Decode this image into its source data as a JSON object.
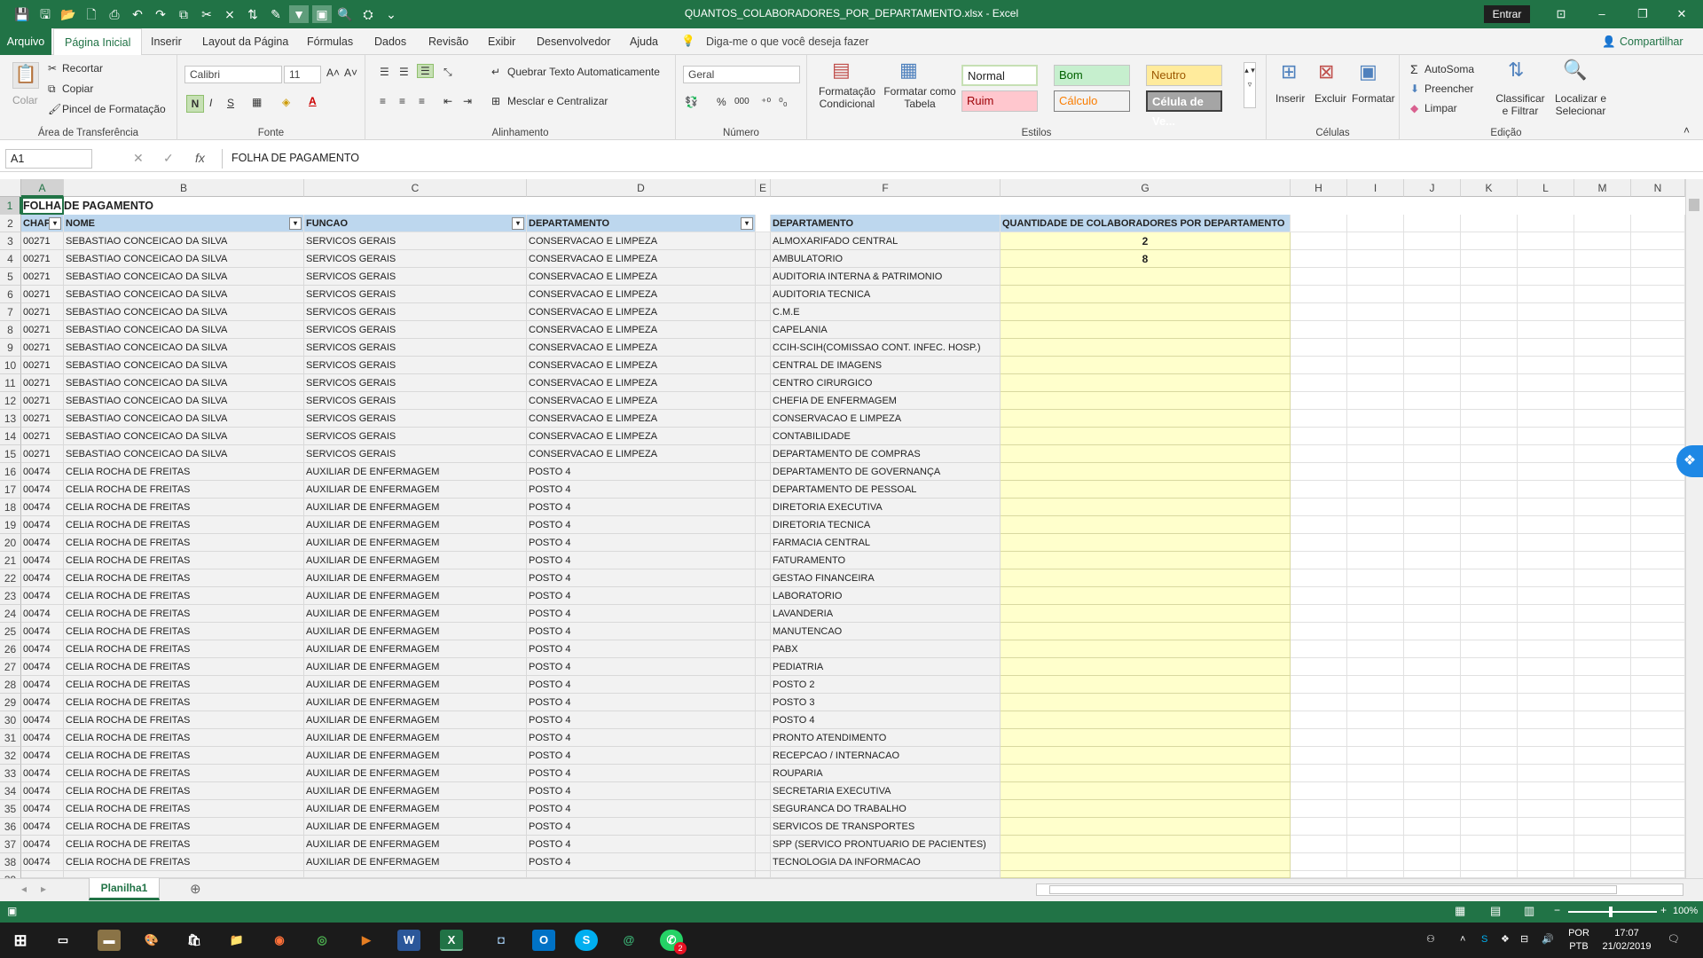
{
  "window": {
    "title": "QUANTOS_COLABORADORES_POR_DEPARTAMENTO.xlsx  -  Excel",
    "signin_label": "Entrar",
    "min": "–",
    "restore": "❐",
    "close": "✕",
    "ribbon_display": "⊡",
    "qat": [
      "💾",
      "🖫",
      "📂",
      "🗋",
      "⎙",
      "↶",
      "↷",
      "⧉",
      "✂",
      "⨯",
      "⇅",
      "✎",
      "▼",
      "▣",
      "🔍",
      "⛭",
      "⌄"
    ]
  },
  "tabs": {
    "file": "Arquivo",
    "items": [
      "Página Inicial",
      "Inserir",
      "Layout da Página",
      "Fórmulas",
      "Dados",
      "Revisão",
      "Exibir",
      "Desenvolvedor",
      "Ajuda"
    ],
    "active": "Página Inicial",
    "tell_me": "Diga-me o que você deseja fazer",
    "share": "Compartilhar"
  },
  "ribbon": {
    "clipboard": {
      "label": "Área de Transferência",
      "paste": "Colar",
      "cut": "Recortar",
      "copy": "Copiar",
      "painter": "Pincel de Formatação"
    },
    "font": {
      "label": "Fonte",
      "name": "Calibri",
      "size": "11",
      "bold": "N",
      "italic": "I",
      "underline": "S",
      "grow": "A˄",
      "shrink": "A˅"
    },
    "alignment": {
      "label": "Alinhamento",
      "wrap": "Quebrar Texto Automaticamente",
      "merge": "Mesclar e Centralizar"
    },
    "number": {
      "label": "Número",
      "format": "Geral",
      "percent": "%",
      "thousands": "000",
      "inc_dec": "⁺⁰",
      "dec_dec": "⁰₀"
    },
    "styles": {
      "label": "Estilos",
      "conditional": "Formatação Condicional",
      "as_table": "Formatar como Tabela",
      "normal": "Normal",
      "good": "Bom",
      "neutral": "Neutro",
      "bad": "Ruim",
      "calc": "Cálculo",
      "check": "Célula de Ve..."
    },
    "cells": {
      "label": "Células",
      "insert": "Inserir",
      "delete": "Excluir",
      "format": "Formatar"
    },
    "editing": {
      "label": "Edição",
      "autosum": "AutoSoma",
      "fill": "Preencher",
      "clear": "Limpar",
      "sort": "Classificar e Filtrar",
      "find": "Localizar e Selecionar"
    }
  },
  "formula_bar": {
    "name_box": "A1",
    "fx": "fx",
    "cancel": "✕",
    "enter": "✓",
    "content": "FOLHA DE PAGAMENTO"
  },
  "sheet": {
    "columns": [
      "A",
      "B",
      "C",
      "D",
      "E",
      "F",
      "G",
      "H",
      "I",
      "J",
      "K",
      "L",
      "M",
      "N"
    ],
    "title": "FOLHA DE PAGAMENTO",
    "headers_left": [
      "CHAPA",
      "NOME",
      "FUNCAO",
      "DEPARTAMENTO"
    ],
    "headers_right": [
      "DEPARTAMENTO",
      "QUANTIDADE DE COLABORADORES POR DEPARTAMENTO"
    ],
    "filter_glyph": "▾",
    "rows_left": [
      [
        "00271",
        "SEBASTIAO CONCEICAO DA SILVA",
        "SERVICOS GERAIS",
        "CONSERVACAO E LIMPEZA"
      ],
      [
        "00271",
        "SEBASTIAO CONCEICAO DA SILVA",
        "SERVICOS GERAIS",
        "CONSERVACAO E LIMPEZA"
      ],
      [
        "00271",
        "SEBASTIAO CONCEICAO DA SILVA",
        "SERVICOS GERAIS",
        "CONSERVACAO E LIMPEZA"
      ],
      [
        "00271",
        "SEBASTIAO CONCEICAO DA SILVA",
        "SERVICOS GERAIS",
        "CONSERVACAO E LIMPEZA"
      ],
      [
        "00271",
        "SEBASTIAO CONCEICAO DA SILVA",
        "SERVICOS GERAIS",
        "CONSERVACAO E LIMPEZA"
      ],
      [
        "00271",
        "SEBASTIAO CONCEICAO DA SILVA",
        "SERVICOS GERAIS",
        "CONSERVACAO E LIMPEZA"
      ],
      [
        "00271",
        "SEBASTIAO CONCEICAO DA SILVA",
        "SERVICOS GERAIS",
        "CONSERVACAO E LIMPEZA"
      ],
      [
        "00271",
        "SEBASTIAO CONCEICAO DA SILVA",
        "SERVICOS GERAIS",
        "CONSERVACAO E LIMPEZA"
      ],
      [
        "00271",
        "SEBASTIAO CONCEICAO DA SILVA",
        "SERVICOS GERAIS",
        "CONSERVACAO E LIMPEZA"
      ],
      [
        "00271",
        "SEBASTIAO CONCEICAO DA SILVA",
        "SERVICOS GERAIS",
        "CONSERVACAO E LIMPEZA"
      ],
      [
        "00271",
        "SEBASTIAO CONCEICAO DA SILVA",
        "SERVICOS GERAIS",
        "CONSERVACAO E LIMPEZA"
      ],
      [
        "00271",
        "SEBASTIAO CONCEICAO DA SILVA",
        "SERVICOS GERAIS",
        "CONSERVACAO E LIMPEZA"
      ],
      [
        "00271",
        "SEBASTIAO CONCEICAO DA SILVA",
        "SERVICOS GERAIS",
        "CONSERVACAO E LIMPEZA"
      ],
      [
        "00474",
        "CELIA ROCHA DE FREITAS",
        "AUXILIAR DE ENFERMAGEM",
        "POSTO 4"
      ],
      [
        "00474",
        "CELIA ROCHA DE FREITAS",
        "AUXILIAR DE ENFERMAGEM",
        "POSTO 4"
      ],
      [
        "00474",
        "CELIA ROCHA DE FREITAS",
        "AUXILIAR DE ENFERMAGEM",
        "POSTO 4"
      ],
      [
        "00474",
        "CELIA ROCHA DE FREITAS",
        "AUXILIAR DE ENFERMAGEM",
        "POSTO 4"
      ],
      [
        "00474",
        "CELIA ROCHA DE FREITAS",
        "AUXILIAR DE ENFERMAGEM",
        "POSTO 4"
      ],
      [
        "00474",
        "CELIA ROCHA DE FREITAS",
        "AUXILIAR DE ENFERMAGEM",
        "POSTO 4"
      ],
      [
        "00474",
        "CELIA ROCHA DE FREITAS",
        "AUXILIAR DE ENFERMAGEM",
        "POSTO 4"
      ],
      [
        "00474",
        "CELIA ROCHA DE FREITAS",
        "AUXILIAR DE ENFERMAGEM",
        "POSTO 4"
      ],
      [
        "00474",
        "CELIA ROCHA DE FREITAS",
        "AUXILIAR DE ENFERMAGEM",
        "POSTO 4"
      ],
      [
        "00474",
        "CELIA ROCHA DE FREITAS",
        "AUXILIAR DE ENFERMAGEM",
        "POSTO 4"
      ],
      [
        "00474",
        "CELIA ROCHA DE FREITAS",
        "AUXILIAR DE ENFERMAGEM",
        "POSTO 4"
      ],
      [
        "00474",
        "CELIA ROCHA DE FREITAS",
        "AUXILIAR DE ENFERMAGEM",
        "POSTO 4"
      ],
      [
        "00474",
        "CELIA ROCHA DE FREITAS",
        "AUXILIAR DE ENFERMAGEM",
        "POSTO 4"
      ],
      [
        "00474",
        "CELIA ROCHA DE FREITAS",
        "AUXILIAR DE ENFERMAGEM",
        "POSTO 4"
      ],
      [
        "00474",
        "CELIA ROCHA DE FREITAS",
        "AUXILIAR DE ENFERMAGEM",
        "POSTO 4"
      ],
      [
        "00474",
        "CELIA ROCHA DE FREITAS",
        "AUXILIAR DE ENFERMAGEM",
        "POSTO 4"
      ],
      [
        "00474",
        "CELIA ROCHA DE FREITAS",
        "AUXILIAR DE ENFERMAGEM",
        "POSTO 4"
      ],
      [
        "00474",
        "CELIA ROCHA DE FREITAS",
        "AUXILIAR DE ENFERMAGEM",
        "POSTO 4"
      ],
      [
        "00474",
        "CELIA ROCHA DE FREITAS",
        "AUXILIAR DE ENFERMAGEM",
        "POSTO 4"
      ],
      [
        "00474",
        "CELIA ROCHA DE FREITAS",
        "AUXILIAR DE ENFERMAGEM",
        "POSTO 4"
      ],
      [
        "00474",
        "CELIA ROCHA DE FREITAS",
        "AUXILIAR DE ENFERMAGEM",
        "POSTO 4"
      ],
      [
        "00474",
        "CELIA ROCHA DE FREITAS",
        "AUXILIAR DE ENFERMAGEM",
        "POSTO 4"
      ],
      [
        "00474",
        "CELIA ROCHA DE FREITAS",
        "AUXILIAR DE ENFERMAGEM",
        "POSTO 4"
      ]
    ],
    "rows_right": [
      [
        "ALMOXARIFADO CENTRAL",
        "2"
      ],
      [
        "AMBULATORIO",
        "8"
      ],
      [
        "AUDITORIA INTERNA & PATRIMONIO",
        ""
      ],
      [
        "AUDITORIA TECNICA",
        ""
      ],
      [
        "C.M.E",
        ""
      ],
      [
        "CAPELANIA",
        ""
      ],
      [
        "CCIH-SCIH(COMISSAO CONT. INFEC. HOSP.)",
        ""
      ],
      [
        "CENTRAL DE IMAGENS",
        ""
      ],
      [
        "CENTRO CIRURGICO",
        ""
      ],
      [
        "CHEFIA DE ENFERMAGEM",
        ""
      ],
      [
        "CONSERVACAO E LIMPEZA",
        ""
      ],
      [
        "CONTABILIDADE",
        ""
      ],
      [
        "DEPARTAMENTO DE COMPRAS",
        ""
      ],
      [
        "DEPARTAMENTO DE GOVERNANÇA",
        ""
      ],
      [
        "DEPARTAMENTO DE PESSOAL",
        ""
      ],
      [
        "DIRETORIA EXECUTIVA",
        ""
      ],
      [
        "DIRETORIA TECNICA",
        ""
      ],
      [
        "FARMACIA CENTRAL",
        ""
      ],
      [
        "FATURAMENTO",
        ""
      ],
      [
        "GESTAO FINANCEIRA",
        ""
      ],
      [
        "LABORATORIO",
        ""
      ],
      [
        "LAVANDERIA",
        ""
      ],
      [
        "MANUTENCAO",
        ""
      ],
      [
        "PABX",
        ""
      ],
      [
        "PEDIATRIA",
        ""
      ],
      [
        "POSTO 2",
        ""
      ],
      [
        "POSTO 3",
        ""
      ],
      [
        "POSTO 4",
        ""
      ],
      [
        "PRONTO ATENDIMENTO",
        ""
      ],
      [
        "RECEPCAO / INTERNACAO",
        ""
      ],
      [
        "ROUPARIA",
        ""
      ],
      [
        "SECRETARIA EXECUTIVA",
        ""
      ],
      [
        "SEGURANCA DO TRABALHO",
        ""
      ],
      [
        "SERVICOS DE TRANSPORTES",
        ""
      ],
      [
        "SPP (SERVICO PRONTUARIO DE PACIENTES)",
        ""
      ],
      [
        "TECNOLOGIA DA INFORMACAO",
        ""
      ]
    ],
    "sheet_tab": "Planilha1",
    "add_sheet": "⊕"
  },
  "status": {
    "zoom": "100%"
  },
  "taskbar": {
    "lang1": "POR",
    "lang2": "PTB",
    "time": "17:07",
    "date": "21/02/2019",
    "badge": "2"
  },
  "colors": {
    "excel_green": "#217346",
    "header_blue": "#bdd7ee",
    "yellow": "#ffffcc"
  }
}
